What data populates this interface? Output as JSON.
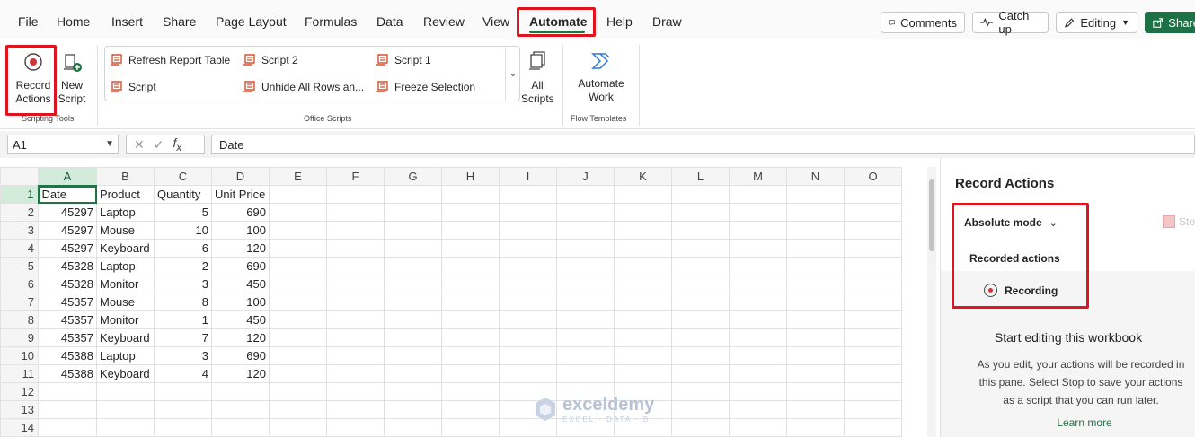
{
  "menu": {
    "items": [
      "File",
      "Home",
      "Insert",
      "Share",
      "Page Layout",
      "Formulas",
      "Data",
      "Review",
      "View",
      "Automate",
      "Help",
      "Draw"
    ],
    "active": "Automate"
  },
  "top_buttons": {
    "comments": "Comments",
    "catch_up": "Catch up",
    "editing": "Editing",
    "share": "Share"
  },
  "ribbon": {
    "record_actions": "Record Actions",
    "new_script": "New Script",
    "scripting_tools_label": "Scripting Tools",
    "scripts": [
      "Refresh Report Table",
      "Script 2",
      "Script 1",
      "Script",
      "Unhide All Rows an...",
      "Freeze Selection"
    ],
    "office_scripts_label": "Office Scripts",
    "all_scripts": "All Scripts",
    "automate_work": "Automate Work",
    "flow_templates_label": "Flow Templates"
  },
  "formula_bar": {
    "name_box": "A1",
    "formula": "Date"
  },
  "sheet": {
    "columns": [
      "A",
      "B",
      "C",
      "D",
      "E",
      "F",
      "G",
      "H",
      "I",
      "J",
      "K",
      "L",
      "M",
      "N",
      "O"
    ],
    "rows": [
      [
        "Date",
        "Product",
        "Quantity",
        "Unit Price"
      ],
      [
        "45297",
        "Laptop",
        "5",
        "690"
      ],
      [
        "45297",
        "Mouse",
        "10",
        "100"
      ],
      [
        "45297",
        "Keyboard",
        "6",
        "120"
      ],
      [
        "45328",
        "Laptop",
        "2",
        "690"
      ],
      [
        "45328",
        "Monitor",
        "3",
        "450"
      ],
      [
        "45357",
        "Mouse",
        "8",
        "100"
      ],
      [
        "45357",
        "Monitor",
        "1",
        "450"
      ],
      [
        "45357",
        "Keyboard",
        "7",
        "120"
      ],
      [
        "45388",
        "Laptop",
        "3",
        "690"
      ],
      [
        "45388",
        "Keyboard",
        "4",
        "120"
      ],
      [
        "",
        "",
        "",
        ""
      ],
      [
        "",
        "",
        "",
        ""
      ],
      [
        "",
        "",
        "",
        ""
      ]
    ]
  },
  "watermark": {
    "name": "exceldemy",
    "tagline": "EXCEL · DATA · BI"
  },
  "pane": {
    "title": "Record Actions",
    "mode": "Absolute mode",
    "stop": "Stop",
    "recorded_actions": "Recorded actions",
    "recording": "Recording",
    "heading": "Start editing this workbook",
    "description": "As you edit, your actions will be recorded in this pane. Select Stop to save your actions as a script that you can run later.",
    "learn_more": "Learn more"
  },
  "colors": {
    "accent": "#217346",
    "highlight": "#e0141e",
    "script_icon": "#d35230"
  }
}
